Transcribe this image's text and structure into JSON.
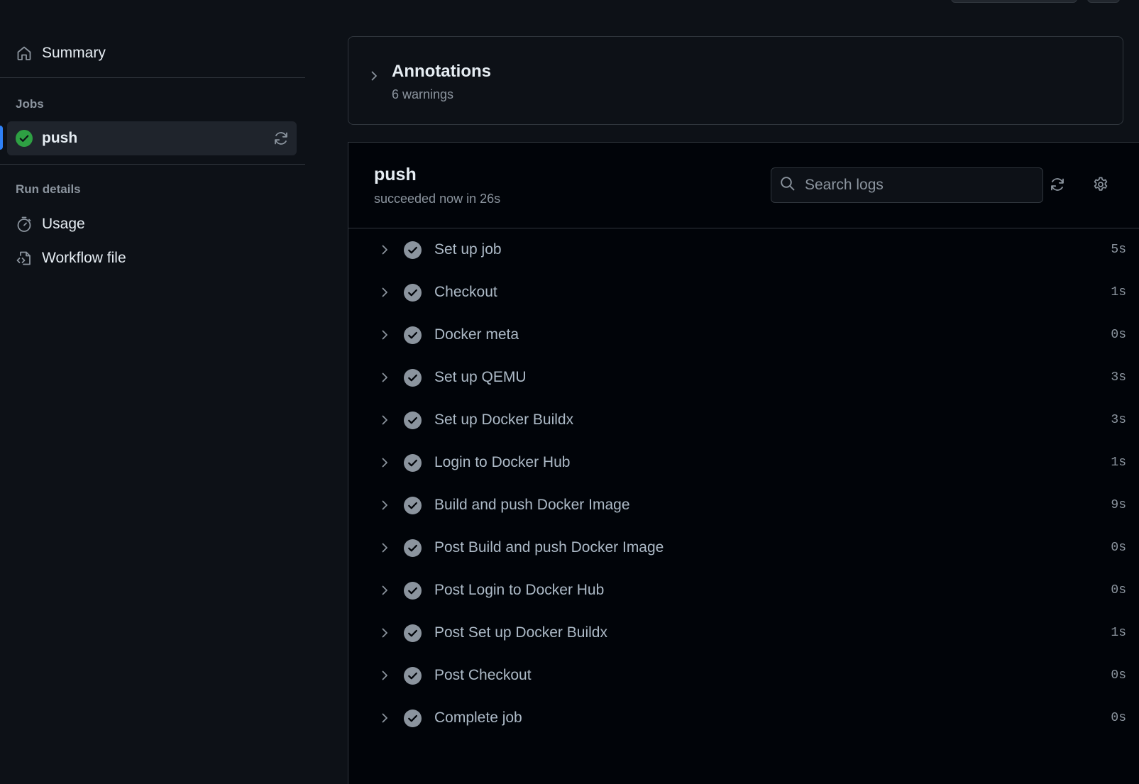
{
  "sidebar": {
    "summary_label": "Summary",
    "jobs_heading": "Jobs",
    "job_name": "push",
    "run_details_heading": "Run details",
    "usage_label": "Usage",
    "workflow_file_label": "Workflow file"
  },
  "annotations": {
    "title": "Annotations",
    "subtitle": "6 warnings"
  },
  "job": {
    "title": "push",
    "status": "succeeded now in 26s",
    "search_placeholder": "Search logs",
    "steps": [
      {
        "name": "Set up job",
        "duration": "5s"
      },
      {
        "name": "Checkout",
        "duration": "1s"
      },
      {
        "name": "Docker meta",
        "duration": "0s"
      },
      {
        "name": "Set up QEMU",
        "duration": "3s"
      },
      {
        "name": "Set up Docker Buildx",
        "duration": "3s"
      },
      {
        "name": "Login to Docker Hub",
        "duration": "1s"
      },
      {
        "name": "Build and push Docker Image",
        "duration": "9s"
      },
      {
        "name": "Post Build and push Docker Image",
        "duration": "0s"
      },
      {
        "name": "Post Login to Docker Hub",
        "duration": "0s"
      },
      {
        "name": "Post Set up Docker Buildx",
        "duration": "1s"
      },
      {
        "name": "Post Checkout",
        "duration": "0s"
      },
      {
        "name": "Complete job",
        "duration": "0s"
      }
    ]
  },
  "colors": {
    "background": "#0d1117",
    "panel": "#010409",
    "border": "#30363d",
    "success": "#2ea043",
    "accent": "#2f81f7",
    "muted": "#8b949e"
  },
  "icons": {
    "summary": "home-icon",
    "job_status": "check-circle-fill-icon",
    "job_rerun": "sync-icon",
    "usage": "stopwatch-icon",
    "workflow_file": "file-code-icon",
    "search": "search-icon",
    "refresh": "sync-icon",
    "settings": "gear-icon",
    "step_status": "check-circle-icon",
    "expand": "chevron-right-icon"
  }
}
